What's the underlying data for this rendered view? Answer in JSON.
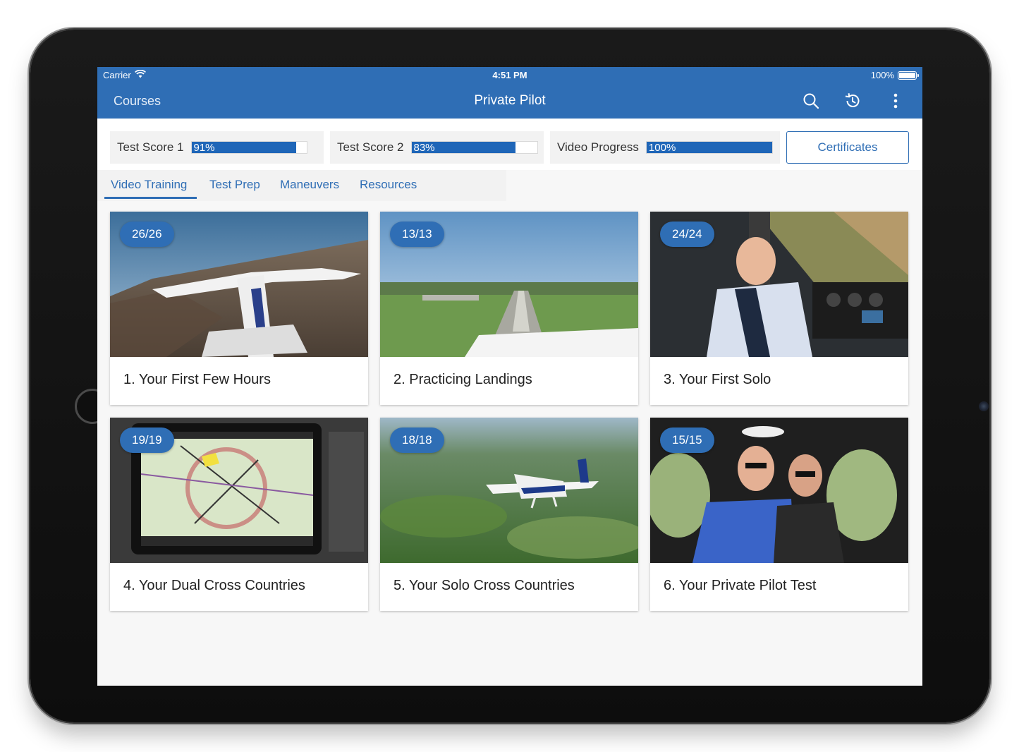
{
  "status": {
    "carrier": "Carrier",
    "time": "4:51 PM",
    "battery": "100%"
  },
  "nav": {
    "back_label": "Courses",
    "title": "Private Pilot",
    "icons": [
      "search-icon",
      "history-icon",
      "more-vertical-icon"
    ]
  },
  "scores": [
    {
      "label": "Test Score 1",
      "value_text": "91%",
      "percent": 91
    },
    {
      "label": "Test Score 2",
      "value_text": "83%",
      "percent": 83
    },
    {
      "label": "Video Progress",
      "value_text": "100%",
      "percent": 100
    }
  ],
  "certificates_label": "Certificates",
  "tabs": [
    "Video Training",
    "Test Prep",
    "Maneuvers",
    "Resources"
  ],
  "active_tab": "Video Training",
  "courses": [
    {
      "badge": "26/26",
      "title": "1. Your First Few Hours"
    },
    {
      "badge": "13/13",
      "title": "2. Practicing Landings"
    },
    {
      "badge": "24/24",
      "title": "3. Your First Solo"
    },
    {
      "badge": "19/19",
      "title": "4. Your Dual Cross Countries"
    },
    {
      "badge": "18/18",
      "title": "5. Your Solo Cross Countries"
    },
    {
      "badge": "15/15",
      "title": "6. Your Private Pilot Test"
    }
  ],
  "colors": {
    "brand": "#2f6eb5",
    "progress": "#1f66b8"
  }
}
